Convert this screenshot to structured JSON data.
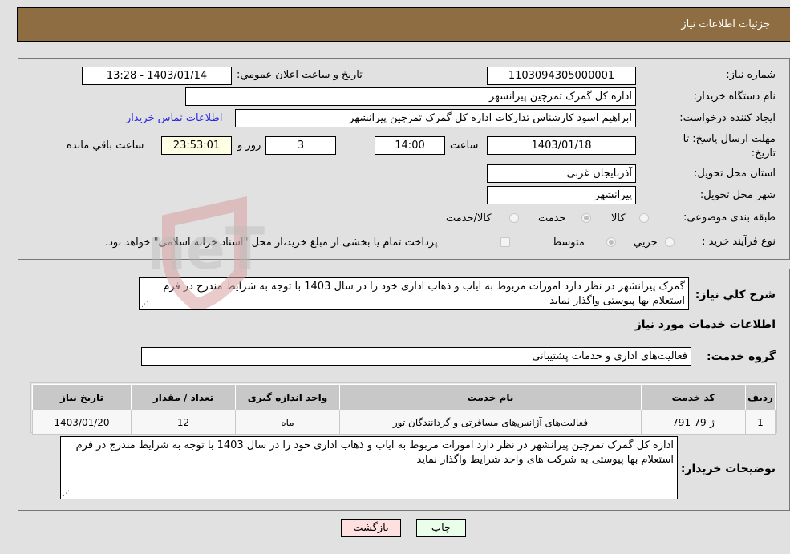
{
  "header": {
    "title": "جزئیات اطلاعات نیاز"
  },
  "details": {
    "need_number": {
      "label": "شماره نیاز:",
      "value": "1103094305000001"
    },
    "announce_datetime": {
      "label": "تاریخ و ساعت اعلان عمومي:",
      "value": "1403/01/14 - 13:28"
    },
    "buyer_org": {
      "label": "نام دستگاه خریدار:",
      "value": "اداره کل گمرک تمرچین پیرانشهر"
    },
    "requester": {
      "label": "ایجاد کننده درخواست:",
      "value": "ابراهیم اسود کارشناس تداركات اداره کل گمرک تمرچین پیرانشهر"
    },
    "buyer_contact_link": "اطلاعات تماس خریدار",
    "deadline": {
      "label": "مهلت ارسال پاسخ: تا تاریخ:",
      "date": "1403/01/18",
      "time_label": "ساعت",
      "time": "14:00",
      "days": "3",
      "days_label": "روز و",
      "remaining": "23:53:01",
      "remaining_label": "ساعت باقي مانده"
    },
    "province": {
      "label": "استان محل تحویل:",
      "value": "آذربایجان غربی"
    },
    "city": {
      "label": "شهر محل تحویل:",
      "value": "پیرانشهر"
    },
    "category": {
      "label": "طبقه بندی موضوعی:",
      "options": [
        "کالا",
        "خدمت",
        "کالا/خدمت"
      ],
      "selected": "خدمت"
    },
    "purchase_type": {
      "label": "نوع فرآیند خرید :",
      "options": [
        "جزيي",
        "متوسط"
      ],
      "selected": "متوسط",
      "treasury_note": "پرداخت تمام یا بخشی از مبلغ خرید،از محل \"اسناد خزانه اسلامی\" خواهد بود."
    }
  },
  "description": {
    "label": "شرح کلي نیاز:",
    "value": "گمرک پیرانشهر در نظر دارد امورات مربوط به ایاب و ذهاب اداری خود را در سال 1403 با توجه به شرایط مندرج در فرم استعلام بها پیوستی واگذار نماید"
  },
  "services": {
    "section_title": "اطلاعات خدمات مورد نیاز",
    "group_label": "گروه خدمت:",
    "group_value": "فعالیت‌های اداری و خدمات پشتیبانی",
    "columns": [
      "ردیف",
      "کد خدمت",
      "نام خدمت",
      "واحد اندازه گیری",
      "تعداد / مقدار",
      "تاریخ نیاز"
    ],
    "rows": [
      {
        "row": "1",
        "code": "ژ-79-791",
        "name": "فعالیت‌های آژانس‌های مسافرتی و گردانندگان تور",
        "unit": "ماه",
        "qty": "12",
        "date": "1403/01/20"
      }
    ]
  },
  "buyer_notes": {
    "label": "توضیحات خریدار:",
    "value": "اداره کل گمرک تمرچین پیرانشهر در نظر دارد امورات مربوط به ایاب و ذهاب اداری خود را در سال 1403 با توجه به شرایط مندرج در فرم استعلام بها پیوستی به شرکت های واجد شرایط واگذار نماید"
  },
  "buttons": {
    "print": "چاپ",
    "back": "بازگشت"
  },
  "watermark": {
    "text": "AriaTender.neT"
  },
  "colors": {
    "header_bg": "#8f6d42",
    "print_bg": "#eaffea",
    "back_bg": "#ffe0e0",
    "remaining_bg": "#ffffe6",
    "link": "#2a2ae0"
  }
}
